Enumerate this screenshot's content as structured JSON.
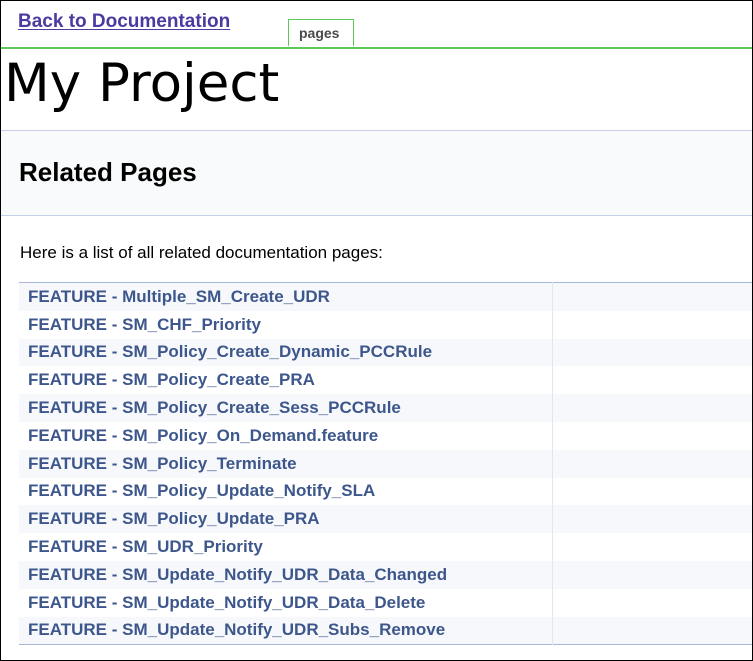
{
  "nav": {
    "back_link": "Back to Documentation",
    "tab_pages": "pages"
  },
  "project": {
    "title": "My Project"
  },
  "header": {
    "title": "Related Pages"
  },
  "intro_text": "Here is a list of all related documentation pages:",
  "pages": [
    "FEATURE - Multiple_SM_Create_UDR",
    "FEATURE - SM_CHF_Priority",
    "FEATURE - SM_Policy_Create_Dynamic_PCCRule",
    "FEATURE - SM_Policy_Create_PRA",
    "FEATURE - SM_Policy_Create_Sess_PCCRule",
    "FEATURE - SM_Policy_On_Demand.feature",
    "FEATURE - SM_Policy_Terminate",
    "FEATURE - SM_Policy_Update_Notify_SLA",
    "FEATURE - SM_Policy_Update_PRA",
    "FEATURE - SM_UDR_Priority",
    "FEATURE - SM_Update_Notify_UDR_Data_Changed",
    "FEATURE - SM_Update_Notify_UDR_Data_Delete",
    "FEATURE - SM_Update_Notify_UDR_Subs_Remove"
  ],
  "colors": {
    "link": "#3d578c",
    "back_link": "#4b3aa0",
    "tab_border": "#5cc85c",
    "header_band": "#f9fafc",
    "row_alt": "#f7f8fb"
  }
}
